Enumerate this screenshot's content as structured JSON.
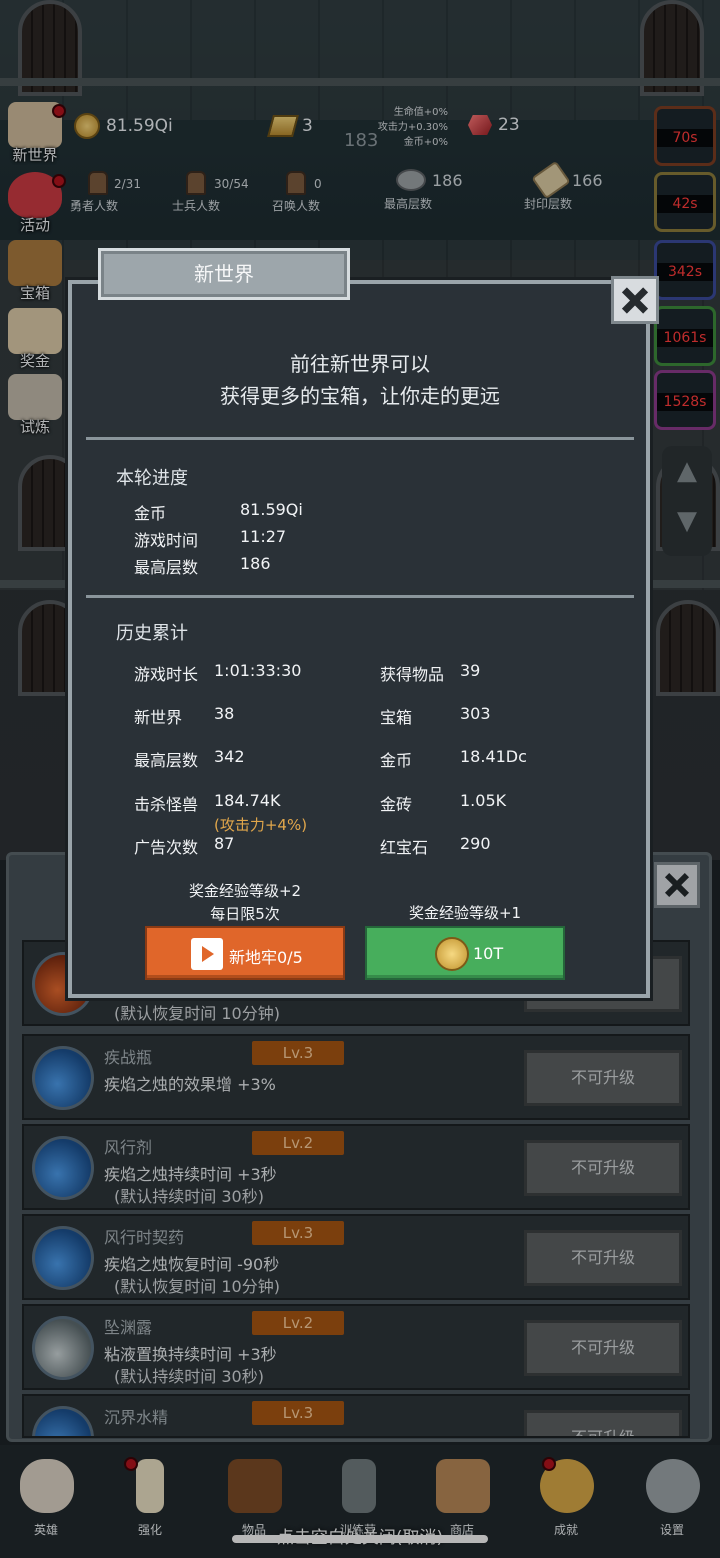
{
  "hud": {
    "gold": "81.59Qi",
    "gold_bars": "3",
    "rubies": "23",
    "floor_big": "183",
    "buffs": [
      "生命值+0%",
      "攻击力+0.30%",
      "金币+0%"
    ],
    "heroes_count": "2/31",
    "heroes_label": "勇者人数",
    "soldiers_count": "30/54",
    "soldiers_label": "士兵人数",
    "summons_count": "0",
    "summons_label": "召唤人数",
    "max_floor": "186",
    "max_floor_label": "最高层数",
    "sealed_floor": "166",
    "sealed_floor_label": "封印层数"
  },
  "side_left": [
    "新世界",
    "活动",
    "宝箱",
    "奖金",
    "试炼"
  ],
  "side_right_timers": [
    "70s",
    "42s",
    "342s",
    "1061s",
    "1528s"
  ],
  "modal": {
    "title": "新世界",
    "intro_line1": "前往新世界可以",
    "intro_line2": "获得更多的宝箱，让你走的更远",
    "current": {
      "heading": "本轮进度",
      "rows": [
        {
          "key": "金币",
          "value": "81.59Qi"
        },
        {
          "key": "游戏时间",
          "value": "11:27"
        },
        {
          "key": "最高层数",
          "value": "186"
        }
      ]
    },
    "history": {
      "heading": "历史累计",
      "left": [
        {
          "key": "游戏时长",
          "value": "1:01:33:30"
        },
        {
          "key": "新世界",
          "value": "38"
        },
        {
          "key": "最高层数",
          "value": "342"
        },
        {
          "key": "击杀怪兽",
          "value": "184.74K"
        },
        {
          "key": "广告次数",
          "value": "87"
        }
      ],
      "kill_bonus": "(攻击力+4%)",
      "right": [
        {
          "key": "获得物品",
          "value": "39"
        },
        {
          "key": "宝箱",
          "value": "303"
        },
        {
          "key": "金币",
          "value": "18.41Dc"
        },
        {
          "key": "金砖",
          "value": "1.05K"
        },
        {
          "key": "红宝石",
          "value": "290"
        }
      ]
    },
    "left_reward_line1": "奖金经验等级+2",
    "left_reward_line2": "每日限5次",
    "right_reward": "奖金经验等级+1",
    "ad_button": "新地牢0/5",
    "coin_button": "10T"
  },
  "list": {
    "partial_top_desc": "(默认恢复时间 10分钟)",
    "items": [
      {
        "name": "疾战瓶",
        "level": "Lv.3",
        "desc1": "疾焰之烛的效果增 +3%",
        "desc2": "",
        "button": "不可升级"
      },
      {
        "name": "风行剂",
        "level": "Lv.2",
        "desc1": "疾焰之烛持续时间 +3秒",
        "desc2": "(默认持续时间 30秒)",
        "button": "不可升级"
      },
      {
        "name": "风行时契药",
        "level": "Lv.3",
        "desc1": "疾焰之烛恢复时间 -90秒",
        "desc2": "(默认恢复时间 10分钟)",
        "button": "不可升级"
      },
      {
        "name": "坠渊露",
        "level": "Lv.2",
        "desc1": "粘液置换持续时间 +3秒",
        "desc2": "(默认持续时间 30秒)",
        "button": "不可升级"
      },
      {
        "name": "沉界水精",
        "level": "Lv.3",
        "desc1": "",
        "desc2": "",
        "button": "不可升级"
      }
    ]
  },
  "nav": [
    "英雄",
    "强化",
    "物品",
    "训练营",
    "商店",
    "成就",
    "设置"
  ],
  "hint": "点击空白处关闭(取消)"
}
